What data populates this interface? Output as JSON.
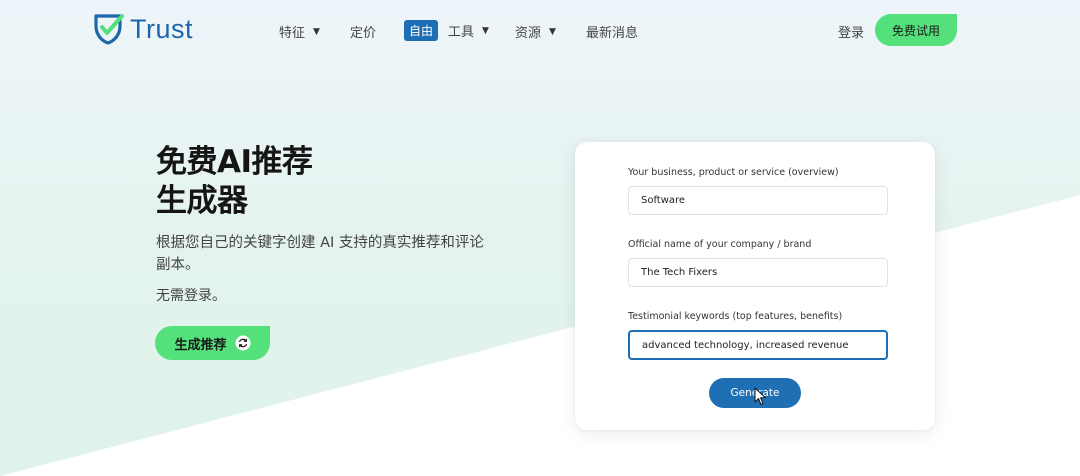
{
  "brand": {
    "name": "Trust",
    "color": "#1d66ab",
    "accent": "#54e07a"
  },
  "nav": {
    "items": [
      {
        "label": "特征",
        "has_dropdown": true
      },
      {
        "label": "定价",
        "has_dropdown": false
      },
      {
        "label": "工具",
        "badge": "自由",
        "has_dropdown": true
      },
      {
        "label": "资源",
        "has_dropdown": true
      },
      {
        "label": "最新消息",
        "has_dropdown": false
      }
    ],
    "login": "登录",
    "cta": "免费试用"
  },
  "hero": {
    "title_line1": "免费AI推荐",
    "title_line2": "生成器",
    "description": "根据您自己的关键字创建 AI 支持的真实推荐和评论副本。",
    "note": "无需登录。",
    "button": "生成推荐"
  },
  "form": {
    "fields": [
      {
        "label": "Your business, product or service (overview)",
        "value": "Software"
      },
      {
        "label": "Official name of your company / brand",
        "value": "The Tech Fixers"
      },
      {
        "label": "Testimonial keywords (top features, benefits)",
        "value": "advanced technology, increased revenue"
      }
    ],
    "submit": "Generate"
  }
}
